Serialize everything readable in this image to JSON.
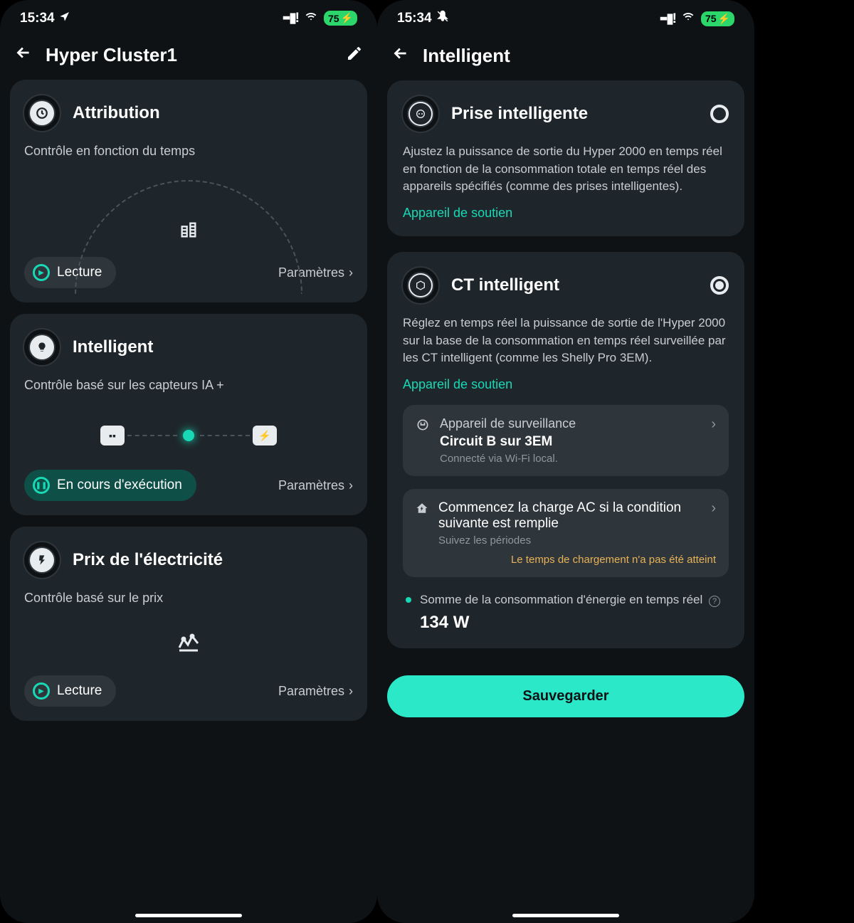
{
  "left": {
    "status": {
      "time": "15:34",
      "battery": "75"
    },
    "header": {
      "title": "Hyper Cluster1"
    },
    "cards": {
      "attribution": {
        "title": "Attribution",
        "subtitle": "Contrôle en fonction du temps",
        "action": "Lecture",
        "settings": "Paramètres"
      },
      "intelligent": {
        "title": "Intelligent",
        "subtitle": "Contrôle basé sur les capteurs IA +",
        "action": "En cours d'exécution",
        "settings": "Paramètres"
      },
      "price": {
        "title": "Prix de l'électricité",
        "subtitle": "Contrôle basé sur le prix",
        "action": "Lecture",
        "settings": "Paramètres"
      }
    }
  },
  "right": {
    "status": {
      "time": "15:34",
      "battery": "75"
    },
    "header": {
      "title": "Intelligent"
    },
    "smart_plug": {
      "title": "Prise intelligente",
      "desc": "Ajustez la puissance de sortie du Hyper 2000 en temps réel en fonction de la consommation totale en temps réel des appareils spécifiés (comme des prises intelligentes).",
      "link": "Appareil de soutien"
    },
    "smart_ct": {
      "title": "CT intelligent",
      "desc": "Réglez en temps réel la puissance de sortie de l'Hyper 2000 sur la base de la consommation en temps réel surveillée par les CT intelligent (comme les Shelly Pro 3EM).",
      "link": "Appareil de soutien",
      "device": {
        "label": "Appareil de surveillance",
        "value": "Circuit B sur 3EM",
        "meta": "Connecté via Wi-Fi local."
      },
      "condition": {
        "label": "Commencez la charge AC si la condition suivante est remplie",
        "meta": "Suivez les périodes",
        "warn": "Le temps de chargement n'a pas été atteint"
      },
      "metric": {
        "label": "Somme de la consommation d'énergie en temps réel",
        "value": "134 W"
      }
    },
    "save": "Sauvegarder"
  }
}
